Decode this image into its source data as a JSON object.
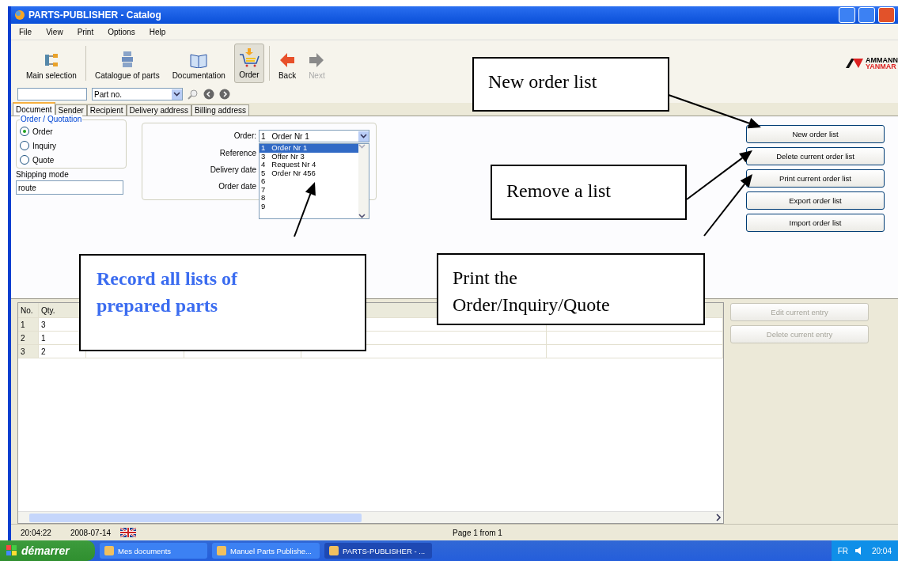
{
  "window": {
    "title": "PARTS-PUBLISHER - Catalog"
  },
  "menu": [
    "File",
    "View",
    "Print",
    "Options",
    "Help"
  ],
  "toolbar": [
    {
      "label": "Main selection",
      "kind": "main",
      "selected": false,
      "disabled": false
    },
    {
      "label": "Catalogue of parts",
      "kind": "catalogue",
      "selected": false,
      "disabled": false
    },
    {
      "label": "Documentation",
      "kind": "book",
      "selected": false,
      "disabled": false
    },
    {
      "label": "Order",
      "kind": "cart",
      "selected": true,
      "disabled": false
    },
    {
      "label": "Back",
      "kind": "back",
      "selected": false,
      "disabled": false
    },
    {
      "label": "Next",
      "kind": "next",
      "selected": false,
      "disabled": true
    }
  ],
  "logo": {
    "line_1": "AMMANN",
    "line_2": "YANMAR"
  },
  "search": {
    "field_select": "Part no."
  },
  "tabs": [
    {
      "label": "Document",
      "selected": true
    },
    {
      "label": "Sender",
      "selected": false
    },
    {
      "label": "Recipient",
      "selected": false
    },
    {
      "label": "Delivery address",
      "selected": false
    },
    {
      "label": "Billing address",
      "selected": false
    }
  ],
  "group": {
    "title": "Order / Quotation",
    "options": [
      {
        "label": "Order",
        "selected": true
      },
      {
        "label": "Inquiry",
        "selected": false
      },
      {
        "label": "Quote",
        "selected": false
      }
    ]
  },
  "shipping": {
    "label": "Shipping mode",
    "value": "route"
  },
  "order_form": {
    "order_label": "Order:",
    "order_value_no": "1",
    "order_value": "Order Nr 1",
    "labels": [
      "Reference",
      "Delivery date",
      "Order date"
    ],
    "list": [
      {
        "no": "1",
        "name": "Order Nr 1",
        "selected": true
      },
      {
        "no": "3",
        "name": "Offer Nr 3",
        "selected": false
      },
      {
        "no": "4",
        "name": "Request Nr 4",
        "selected": false
      },
      {
        "no": "5",
        "name": "Order Nr 456",
        "selected": false
      },
      {
        "no": "6",
        "selected": false
      },
      {
        "no": "7",
        "selected": false
      },
      {
        "no": "8",
        "selected": false
      },
      {
        "no": "9",
        "selected": false
      }
    ]
  },
  "list_buttons": [
    "New order list",
    "Delete current order list",
    "Print current order list",
    "Export order list",
    "Import order list"
  ],
  "table": {
    "columns": [
      "No.",
      "Qty."
    ],
    "rows": [
      [
        "1",
        "3"
      ],
      [
        "2",
        "1"
      ],
      [
        "3",
        "2"
      ]
    ]
  },
  "entry_buttons": [
    {
      "label": "Edit current entry",
      "disabled": true
    },
    {
      "label": "Delete current entry",
      "disabled": true
    }
  ],
  "status_bar": {
    "time": "20:04:22",
    "date": "2008-07-14",
    "page": "Page 1 from 1"
  },
  "taskbar": {
    "start": "démarrer",
    "tasks": [
      {
        "label": "Mes documents",
        "selected": false
      },
      {
        "label": "Manuel Parts Publishe...",
        "selected": false
      },
      {
        "label": "PARTS-PUBLISHER - ...",
        "selected": true
      }
    ],
    "lang": "FR",
    "clock": "20:04"
  },
  "callouts": [
    {
      "text": "New order list",
      "kind": "plain"
    },
    {
      "text": "Remove a list",
      "kind": "plain"
    },
    {
      "text": "Record all lists of prepared parts",
      "kind": "blue"
    },
    {
      "text": "Print the Order/Inquiry/Quote",
      "kind": "plain"
    }
  ]
}
